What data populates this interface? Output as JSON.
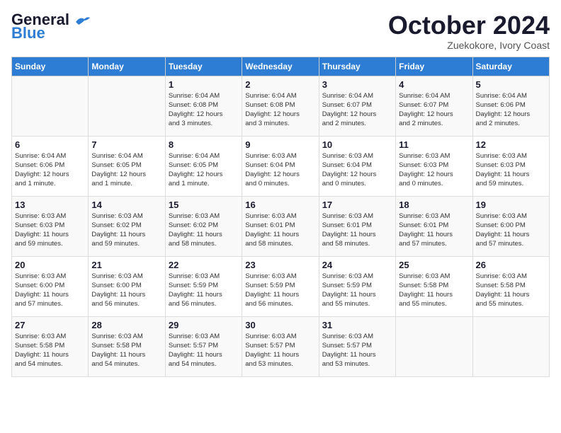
{
  "logo": {
    "line1": "General",
    "line2": "Blue"
  },
  "title": "October 2024",
  "subtitle": "Zuekokore, Ivory Coast",
  "days_header": [
    "Sunday",
    "Monday",
    "Tuesday",
    "Wednesday",
    "Thursday",
    "Friday",
    "Saturday"
  ],
  "weeks": [
    [
      {
        "day": "",
        "info": ""
      },
      {
        "day": "",
        "info": ""
      },
      {
        "day": "1",
        "info": "Sunrise: 6:04 AM\nSunset: 6:08 PM\nDaylight: 12 hours\nand 3 minutes."
      },
      {
        "day": "2",
        "info": "Sunrise: 6:04 AM\nSunset: 6:08 PM\nDaylight: 12 hours\nand 3 minutes."
      },
      {
        "day": "3",
        "info": "Sunrise: 6:04 AM\nSunset: 6:07 PM\nDaylight: 12 hours\nand 2 minutes."
      },
      {
        "day": "4",
        "info": "Sunrise: 6:04 AM\nSunset: 6:07 PM\nDaylight: 12 hours\nand 2 minutes."
      },
      {
        "day": "5",
        "info": "Sunrise: 6:04 AM\nSunset: 6:06 PM\nDaylight: 12 hours\nand 2 minutes."
      }
    ],
    [
      {
        "day": "6",
        "info": "Sunrise: 6:04 AM\nSunset: 6:06 PM\nDaylight: 12 hours\nand 1 minute."
      },
      {
        "day": "7",
        "info": "Sunrise: 6:04 AM\nSunset: 6:05 PM\nDaylight: 12 hours\nand 1 minute."
      },
      {
        "day": "8",
        "info": "Sunrise: 6:04 AM\nSunset: 6:05 PM\nDaylight: 12 hours\nand 1 minute."
      },
      {
        "day": "9",
        "info": "Sunrise: 6:03 AM\nSunset: 6:04 PM\nDaylight: 12 hours\nand 0 minutes."
      },
      {
        "day": "10",
        "info": "Sunrise: 6:03 AM\nSunset: 6:04 PM\nDaylight: 12 hours\nand 0 minutes."
      },
      {
        "day": "11",
        "info": "Sunrise: 6:03 AM\nSunset: 6:03 PM\nDaylight: 12 hours\nand 0 minutes."
      },
      {
        "day": "12",
        "info": "Sunrise: 6:03 AM\nSunset: 6:03 PM\nDaylight: 11 hours\nand 59 minutes."
      }
    ],
    [
      {
        "day": "13",
        "info": "Sunrise: 6:03 AM\nSunset: 6:03 PM\nDaylight: 11 hours\nand 59 minutes."
      },
      {
        "day": "14",
        "info": "Sunrise: 6:03 AM\nSunset: 6:02 PM\nDaylight: 11 hours\nand 59 minutes."
      },
      {
        "day": "15",
        "info": "Sunrise: 6:03 AM\nSunset: 6:02 PM\nDaylight: 11 hours\nand 58 minutes."
      },
      {
        "day": "16",
        "info": "Sunrise: 6:03 AM\nSunset: 6:01 PM\nDaylight: 11 hours\nand 58 minutes."
      },
      {
        "day": "17",
        "info": "Sunrise: 6:03 AM\nSunset: 6:01 PM\nDaylight: 11 hours\nand 58 minutes."
      },
      {
        "day": "18",
        "info": "Sunrise: 6:03 AM\nSunset: 6:01 PM\nDaylight: 11 hours\nand 57 minutes."
      },
      {
        "day": "19",
        "info": "Sunrise: 6:03 AM\nSunset: 6:00 PM\nDaylight: 11 hours\nand 57 minutes."
      }
    ],
    [
      {
        "day": "20",
        "info": "Sunrise: 6:03 AM\nSunset: 6:00 PM\nDaylight: 11 hours\nand 57 minutes."
      },
      {
        "day": "21",
        "info": "Sunrise: 6:03 AM\nSunset: 6:00 PM\nDaylight: 11 hours\nand 56 minutes."
      },
      {
        "day": "22",
        "info": "Sunrise: 6:03 AM\nSunset: 5:59 PM\nDaylight: 11 hours\nand 56 minutes."
      },
      {
        "day": "23",
        "info": "Sunrise: 6:03 AM\nSunset: 5:59 PM\nDaylight: 11 hours\nand 56 minutes."
      },
      {
        "day": "24",
        "info": "Sunrise: 6:03 AM\nSunset: 5:59 PM\nDaylight: 11 hours\nand 55 minutes."
      },
      {
        "day": "25",
        "info": "Sunrise: 6:03 AM\nSunset: 5:58 PM\nDaylight: 11 hours\nand 55 minutes."
      },
      {
        "day": "26",
        "info": "Sunrise: 6:03 AM\nSunset: 5:58 PM\nDaylight: 11 hours\nand 55 minutes."
      }
    ],
    [
      {
        "day": "27",
        "info": "Sunrise: 6:03 AM\nSunset: 5:58 PM\nDaylight: 11 hours\nand 54 minutes."
      },
      {
        "day": "28",
        "info": "Sunrise: 6:03 AM\nSunset: 5:58 PM\nDaylight: 11 hours\nand 54 minutes."
      },
      {
        "day": "29",
        "info": "Sunrise: 6:03 AM\nSunset: 5:57 PM\nDaylight: 11 hours\nand 54 minutes."
      },
      {
        "day": "30",
        "info": "Sunrise: 6:03 AM\nSunset: 5:57 PM\nDaylight: 11 hours\nand 53 minutes."
      },
      {
        "day": "31",
        "info": "Sunrise: 6:03 AM\nSunset: 5:57 PM\nDaylight: 11 hours\nand 53 minutes."
      },
      {
        "day": "",
        "info": ""
      },
      {
        "day": "",
        "info": ""
      }
    ]
  ]
}
